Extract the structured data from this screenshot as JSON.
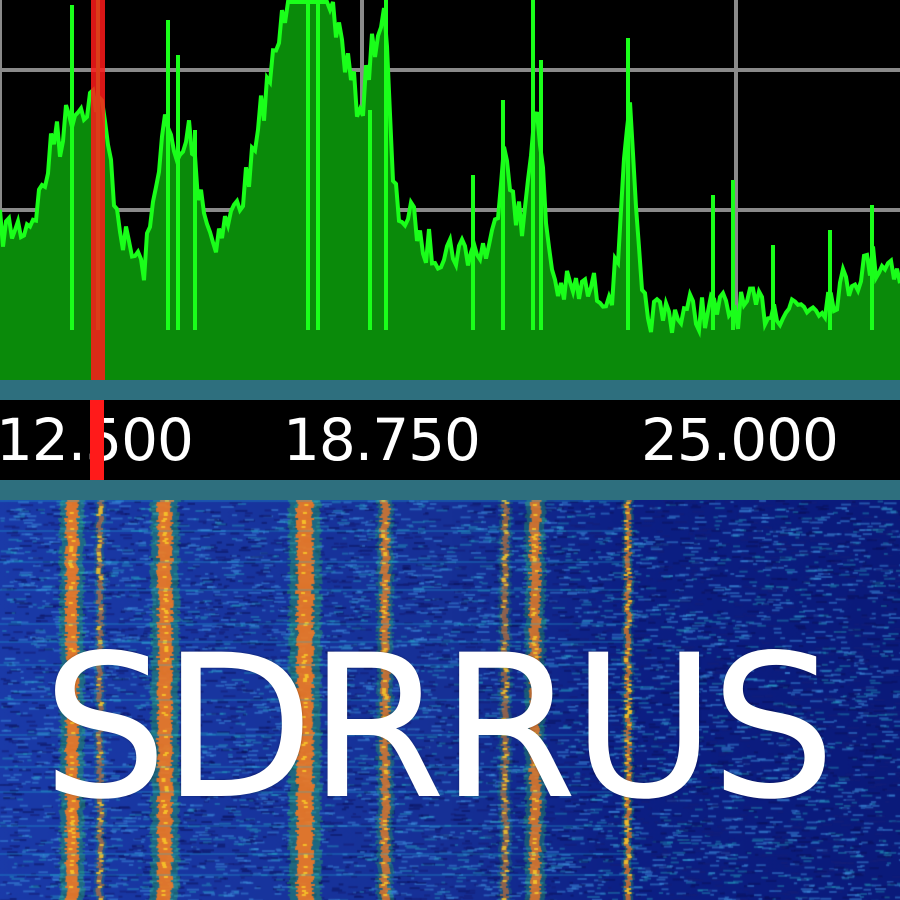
{
  "app": {
    "brand_text": "SDRRUS"
  },
  "frequency_scale": {
    "labels": [
      "12.500",
      "18.750",
      "25.000"
    ],
    "marker_color": "#ff1a1a"
  },
  "spectrum": {
    "grid_color": "#8a8a8a",
    "fill_color": "#0a8a0a",
    "trace_color": "#1aff1a",
    "background": "#000000"
  },
  "waterfall": {
    "background": "#0b1f8a",
    "signal_colors": [
      "#ff5a1a",
      "#f0a020",
      "#30c040"
    ]
  },
  "colors": {
    "separator": "#2e6f7e",
    "text": "#ffffff"
  }
}
